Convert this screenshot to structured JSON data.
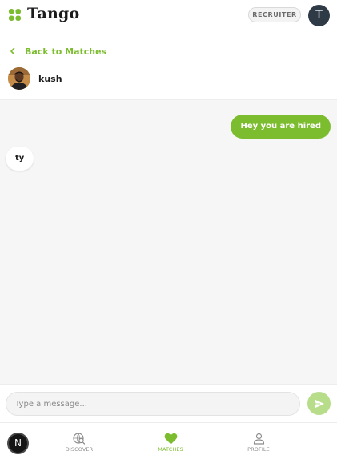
{
  "app": {
    "name": "Tango",
    "logo_icon": "four-leaf-icon"
  },
  "header": {
    "role_badge": "RECRUITER",
    "user_initial": "T"
  },
  "nav_back": {
    "label": "Back to Matches",
    "icon": "chevron-left-icon"
  },
  "contact": {
    "name": "kush"
  },
  "messages": [
    {
      "direction": "outgoing",
      "text": "Hey you are hired"
    },
    {
      "direction": "incoming",
      "text": "ty"
    }
  ],
  "composer": {
    "placeholder": "Type a message...",
    "value": "",
    "send_icon": "paper-plane-icon"
  },
  "bottom_nav": {
    "badge": "N",
    "items": [
      {
        "label": "DISCOVER",
        "icon": "globe-search-icon",
        "active": false
      },
      {
        "label": "MATCHES",
        "icon": "heart-icon",
        "active": true
      },
      {
        "label": "PROFILE",
        "icon": "person-icon",
        "active": false
      }
    ]
  },
  "colors": {
    "accent": "#7cbd2f",
    "send_disabled": "#b7dd8a",
    "chat_bg": "#f6f6f6",
    "avatar_dark": "#2e3a46"
  }
}
